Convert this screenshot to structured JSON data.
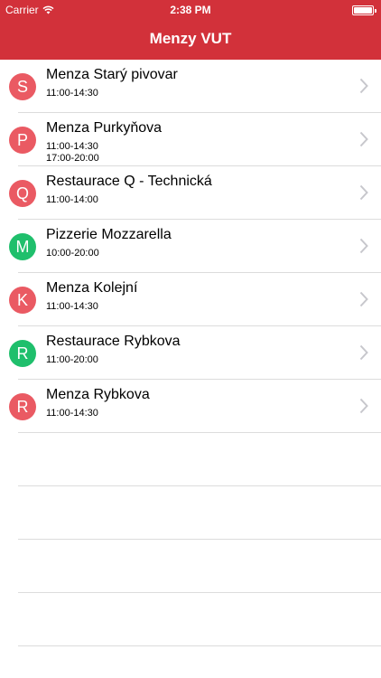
{
  "status_bar": {
    "carrier": "Carrier",
    "time": "2:38 PM"
  },
  "nav": {
    "title": "Menzy VUT"
  },
  "colors": {
    "accent": "#d2313a",
    "avatar_red": "#ea5a63",
    "avatar_green": "#1fbf6c"
  },
  "canteens": [
    {
      "letter": "S",
      "color": "red",
      "name": "Menza Starý pivovar",
      "hours": [
        "11:00-14:30"
      ]
    },
    {
      "letter": "P",
      "color": "red",
      "name": "Menza Purkyňova",
      "hours": [
        "11:00-14:30",
        "17:00-20:00"
      ]
    },
    {
      "letter": "Q",
      "color": "red",
      "name": "Restaurace Q - Technická",
      "hours": [
        "11:00-14:00"
      ]
    },
    {
      "letter": "M",
      "color": "green",
      "name": "Pizzerie Mozzarella",
      "hours": [
        "10:00-20:00"
      ]
    },
    {
      "letter": "K",
      "color": "red",
      "name": "Menza Kolejní",
      "hours": [
        "11:00-14:30"
      ]
    },
    {
      "letter": "R",
      "color": "green",
      "name": "Restaurace Rybkova",
      "hours": [
        "11:00-20:00"
      ]
    },
    {
      "letter": "R",
      "color": "red",
      "name": "Menza Rybkova",
      "hours": [
        "11:00-14:30"
      ]
    }
  ]
}
